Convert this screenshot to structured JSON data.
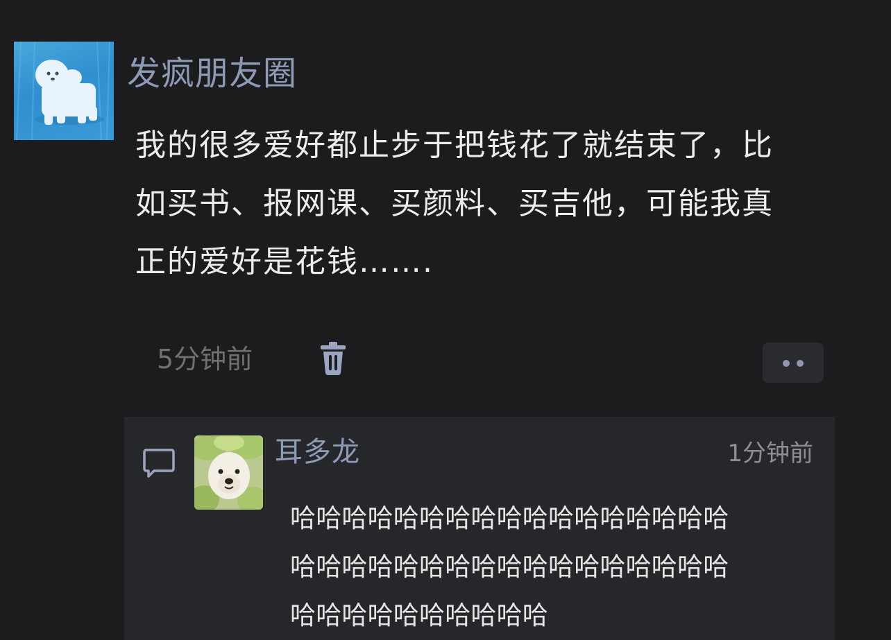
{
  "post": {
    "author": "发疯朋友圈",
    "avatar_icon": "white-dog-figure-avatar",
    "text_lines": [
      "我的很多爱好都止步于把钱花了就结束了，比",
      "如买书、报网课、买颜料、买吉他，可能我真",
      "正的爱好是花钱……."
    ],
    "time": "5分钟前",
    "delete_icon": "trash-icon",
    "more_icon": "more-dots-icon"
  },
  "comments": [
    {
      "icon": "comment-bubble-icon",
      "author": "耳多龙",
      "avatar_icon": "dog-with-cabbage-avatar",
      "time": "1分钟前",
      "text_lines": [
        "哈哈哈哈哈哈哈哈哈哈哈哈哈哈哈哈哈",
        "哈哈哈哈哈哈哈哈哈哈哈哈哈哈哈哈哈",
        "哈哈哈哈哈哈哈哈哈哈"
      ]
    }
  ],
  "colors": {
    "background": "#1c1c1e",
    "name_accent": "#8d9bb6",
    "comment_panel": "#26272b"
  }
}
